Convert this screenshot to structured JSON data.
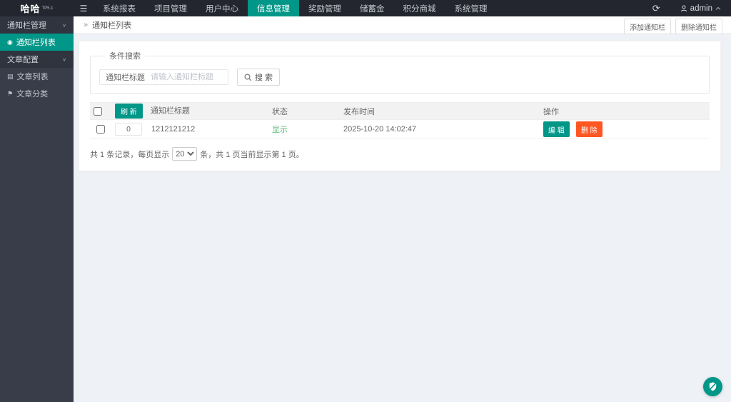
{
  "topbar": {
    "logo": "哈哈",
    "logo_version": "TP5.1",
    "hamburger": "☰",
    "nav": [
      {
        "label": "系统报表"
      },
      {
        "label": "项目管理"
      },
      {
        "label": "用户中心"
      },
      {
        "label": "信息管理"
      },
      {
        "label": "奖励管理"
      },
      {
        "label": "储蓄金"
      },
      {
        "label": "积分商城"
      },
      {
        "label": "系统管理"
      }
    ],
    "refresh_icon": "⟳",
    "username": "admin"
  },
  "sidebar": {
    "groups": [
      {
        "label": "通知栏管理",
        "chevron": "∨",
        "items": [
          {
            "icon": "◉",
            "label": "通知栏列表"
          }
        ]
      },
      {
        "label": "文章配置",
        "chevron": "∨",
        "items": [
          {
            "icon": "▤",
            "label": "文章列表"
          },
          {
            "icon": "⚑",
            "label": "文章分类"
          }
        ]
      }
    ]
  },
  "breadcrumb": {
    "separator": "»",
    "current": "通知栏列表"
  },
  "page_actions": {
    "add": "添加通知栏",
    "remove": "删除通知栏"
  },
  "search": {
    "legend": "条件搜索",
    "field_label": "通知栏标题",
    "placeholder": "请输入通知栏标题",
    "button": "搜 索"
  },
  "table": {
    "refresh": "刷 新",
    "headers": {
      "title": "通知栏标题",
      "status": "状态",
      "publish_time": "发布时间",
      "actions": "操作"
    },
    "rows": [
      {
        "sort": "0",
        "title": "1212121212",
        "status": "显示",
        "publish_time": "2025-10-20 14:02:47",
        "edit": "编 辑",
        "remove": "删 除"
      }
    ]
  },
  "pagination": {
    "prefix": "共 1 条记录，每页显示",
    "page_size": "20",
    "suffix": "条，共 1 页当前显示第 1 页。"
  },
  "colors": {
    "accent": "#009688",
    "danger": "#ff5722",
    "status_green": "#5fb878",
    "header_bg": "#23262e",
    "sidebar_bg": "#393d49"
  }
}
